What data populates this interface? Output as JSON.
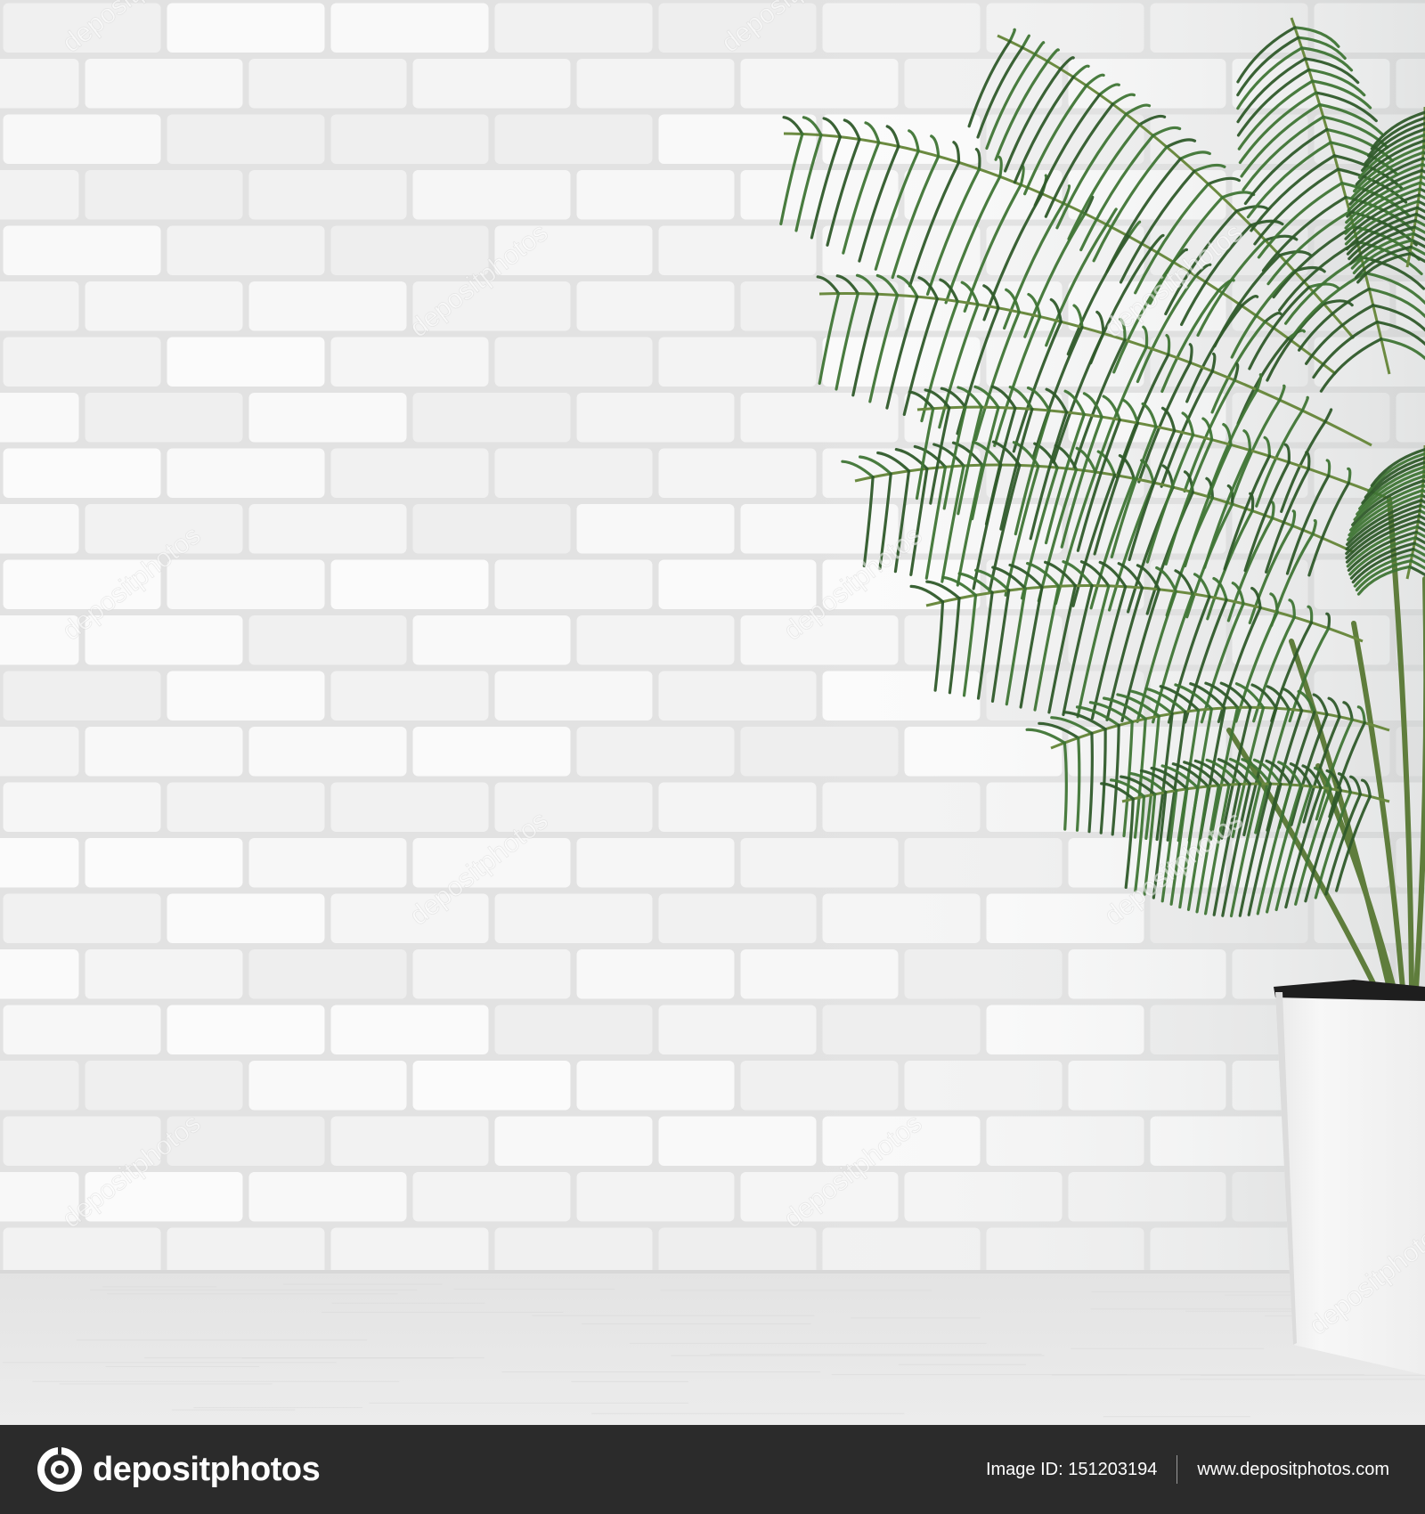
{
  "image": {
    "description_colors": {
      "wall": "#f1f1f1",
      "mortar": "#e1e1e1",
      "floor": "#e6e6e6",
      "leaf_dark": "#2f5a2a",
      "leaf_mid": "#3f7535",
      "pot": "#f3f3f3",
      "footer_bg": "#2b2b2b"
    },
    "watermark_text": "depositphotos"
  },
  "footer": {
    "brand_name": "depositphotos",
    "image_id_label": "Image ID: 151203194",
    "website": "www.depositphotos.com"
  }
}
